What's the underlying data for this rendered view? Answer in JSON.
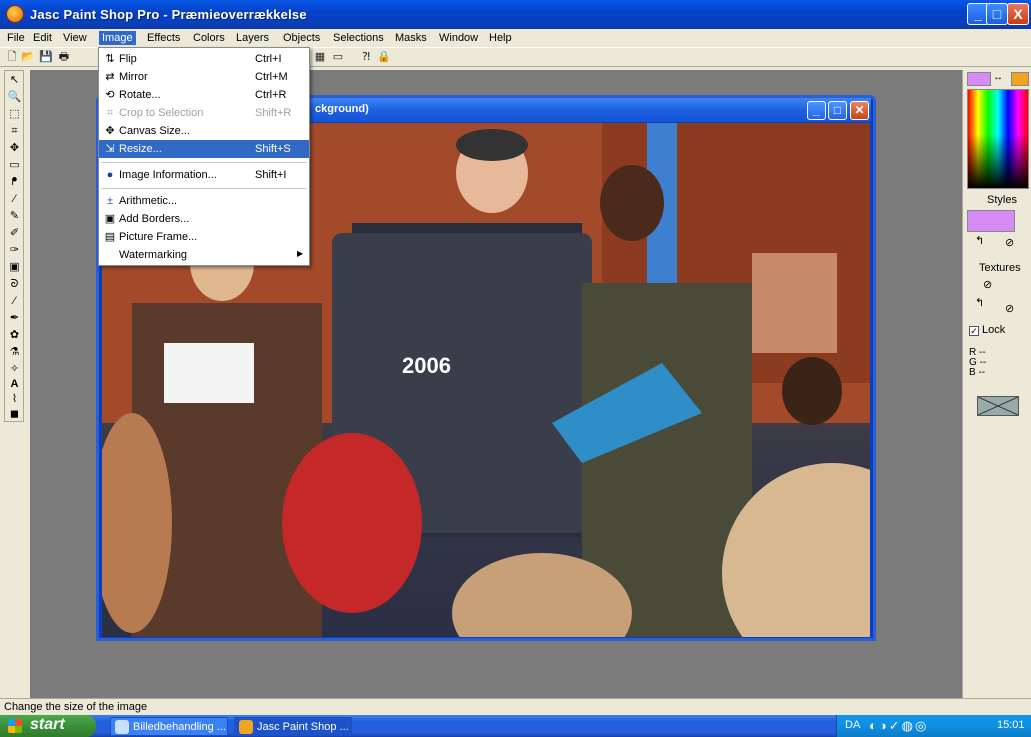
{
  "window": {
    "title": "Jasc Paint Shop Pro - Præmieoverrækkelse",
    "controls": [
      "_",
      "□",
      "X"
    ]
  },
  "menubar": {
    "items": [
      "File",
      "Edit",
      "View",
      "Image",
      "Effects",
      "Colors",
      "Layers",
      "Objects",
      "Selections",
      "Masks",
      "Window",
      "Help"
    ],
    "active": "Image"
  },
  "image_menu": {
    "items": [
      {
        "label": "Flip",
        "shortcut": "Ctrl+I",
        "icon": "flip-icon"
      },
      {
        "label": "Mirror",
        "shortcut": "Ctrl+M",
        "icon": "mirror-icon"
      },
      {
        "label": "Rotate...",
        "shortcut": "Ctrl+R",
        "icon": "rotate-icon"
      },
      {
        "label": "Crop to Selection",
        "shortcut": "Shift+R",
        "icon": "crop-icon",
        "disabled": true
      },
      {
        "label": "Canvas Size...",
        "shortcut": "",
        "icon": "canvas-size-icon"
      },
      {
        "label": "Resize...",
        "shortcut": "Shift+S",
        "icon": "resize-icon",
        "highlighted": true
      },
      {
        "label": "Image Information...",
        "shortcut": "Shift+I",
        "icon": "info-icon"
      },
      {
        "label": "Arithmetic...",
        "shortcut": "",
        "icon": "arithmetic-icon"
      },
      {
        "label": "Add Borders...",
        "shortcut": "",
        "icon": "borders-icon"
      },
      {
        "label": "Picture Frame...",
        "shortcut": "",
        "icon": "frame-icon"
      },
      {
        "label": "Watermarking",
        "shortcut": "",
        "icon": "",
        "submenu": true
      }
    ]
  },
  "document": {
    "title_visible": "ckground)"
  },
  "right_panel": {
    "styles_label": "Styles",
    "textures_label": "Textures",
    "lock_label": "Lock",
    "rgb": [
      "R",
      "G",
      "B"
    ],
    "rgb_values": [
      "--",
      "--",
      "--"
    ]
  },
  "statusbar": {
    "text": "Change the size of the image"
  },
  "taskbar": {
    "start_label": "start",
    "tasks": [
      "Billedbehandling ...",
      "Jasc Paint Shop ..."
    ],
    "lang": "DA",
    "clock": "15:01"
  },
  "colors": {
    "titlebar": "#0542c8",
    "menu_highlight": "#316ac5",
    "foreground_swatch": "#d78bf4",
    "background_swatch": "#f2a420"
  }
}
